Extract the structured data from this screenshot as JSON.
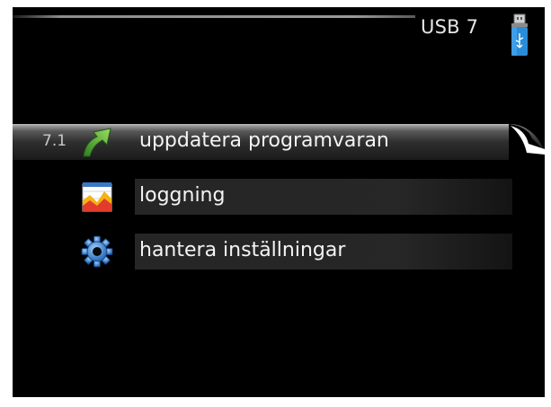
{
  "header": {
    "title": "USB 7"
  },
  "menu": {
    "items": [
      {
        "number": "7.1",
        "label": "uppdatera programvaran",
        "icon": "update-arrow-icon",
        "selected": true
      },
      {
        "number": "",
        "label": "loggning",
        "icon": "chart-log-icon",
        "selected": false
      },
      {
        "number": "",
        "label": "hantera inställningar",
        "icon": "gear-icon",
        "selected": false
      }
    ]
  },
  "colors": {
    "background": "#000000",
    "text": "#f4f4f4",
    "usb_blue": "#2a8cd8",
    "update_green": "#4cae3a"
  }
}
